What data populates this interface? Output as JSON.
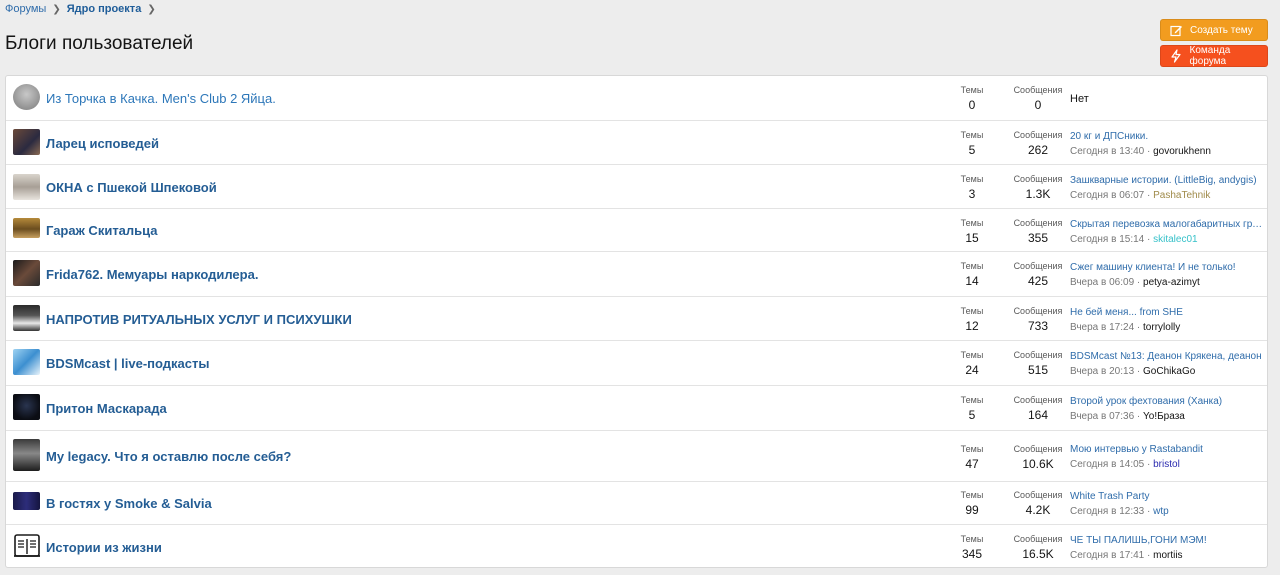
{
  "breadcrumbs": [
    {
      "label": "Форумы"
    },
    {
      "label": "Ядро проекта"
    }
  ],
  "page_title": "Блоги пользователей",
  "buttons": {
    "create_thread": "Создать тему",
    "forum_team": "Команда форума"
  },
  "colors": {
    "create_button": "#f29c1f",
    "team_button": "#f5501e",
    "link": "#245d94"
  },
  "stats_labels": {
    "threads": "Темы",
    "messages": "Сообщения"
  },
  "nodes": [
    {
      "title": "Из Торчка в Качка. Men's Club 2 Яйца.",
      "threads": "0",
      "messages": "0",
      "none_label": "Нет"
    },
    {
      "title": "Ларец исповедей",
      "threads": "5",
      "messages": "262",
      "last_title": "20 кг и ДПСники.",
      "last_time": "Сегодня в 13:40",
      "last_user": "govorukhenn",
      "user_color": "#141414"
    },
    {
      "title": "ОКНА с Пшекой Шпековой",
      "threads": "3",
      "messages": "1.3K",
      "last_title": "Зашкварные истории. (LittleBig, andygis)",
      "last_time": "Сегодня в 06:07",
      "last_user": "PashaTehnik",
      "user_color": "#a08b4a"
    },
    {
      "title": "Гараж Скитальца",
      "threads": "15",
      "messages": "355",
      "last_title": "Скрытая перевозка малогабаритных грузов",
      "last_time": "Сегодня в 15:14",
      "last_user": "skitalec01",
      "user_color": "#36c1c9"
    },
    {
      "title": "Frida762. Мемуары наркодилера.",
      "threads": "14",
      "messages": "425",
      "last_title": "Сжег машину клиента! И не только!",
      "last_time": "Вчера в 06:09",
      "last_user": "petya-azimyt",
      "user_color": "#141414"
    },
    {
      "title": "НАПРОТИВ РИТУАЛЬНЫХ УСЛУГ И ПСИХУШКИ",
      "threads": "12",
      "messages": "733",
      "last_title": "Не бей меня... from SHE",
      "last_time": "Вчера в 17:24",
      "last_user": "torrylolly",
      "user_color": "#141414"
    },
    {
      "title": "BDSMcast | live-подкасты",
      "threads": "24",
      "messages": "515",
      "last_title": "BDSMcast №13: Деанон Крякена, деанон",
      "last_time": "Вчера в 20:13",
      "last_user": "GoChikaGo",
      "user_color": "#141414"
    },
    {
      "title": "Притон Маскарада",
      "threads": "5",
      "messages": "164",
      "last_title": "Второй урок фехтования (Ханка)",
      "last_time": "Вчера в 07:36",
      "last_user": "Yo!Бpаза",
      "user_color": "#141414"
    },
    {
      "title": "My legacy. Что я оставлю после себя?",
      "threads": "47",
      "messages": "10.6K",
      "last_title": "Мою интервью у Rastabandit",
      "last_time": "Сегодня в 14:05",
      "last_user": "bristol",
      "user_color": "#2b2bb0"
    },
    {
      "title": "В гостях у Smoke & Salvia",
      "threads": "99",
      "messages": "4.2K",
      "last_title": "White Trash Party",
      "last_time": "Сегодня в 12:33",
      "last_user": "wtp",
      "user_color": "#2f6caa"
    },
    {
      "title": "Истории из жизни",
      "threads": "345",
      "messages": "16.5K",
      "last_title": "ЧЕ ТЫ ПАЛИШЬ,ГОНИ МЭМ!",
      "last_time": "Сегодня в 17:41",
      "last_user": "mortiis",
      "user_color": "#141414"
    }
  ]
}
